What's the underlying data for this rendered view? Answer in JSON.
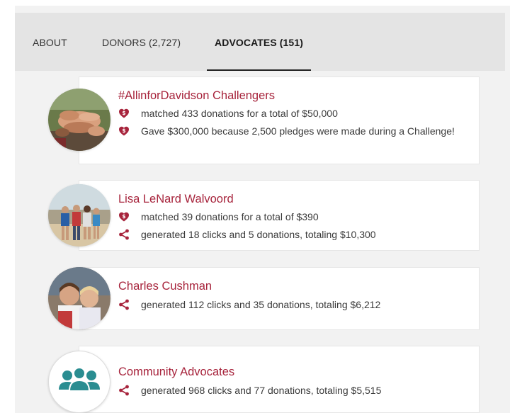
{
  "tabs": [
    {
      "label": "ABOUT",
      "active": false
    },
    {
      "label": "DONORS (2,727)",
      "active": false
    },
    {
      "label": "ADVOCATES (151)",
      "active": true
    }
  ],
  "colors": {
    "accent": "#a7243c",
    "share": "#a7243c",
    "community_icon": "#2a8d91"
  },
  "advocates": [
    {
      "name": "#AllinforDavidson Challengers",
      "avatar": "photo-hands-stacked",
      "lines": [
        {
          "icon": "heart-dollar-icon",
          "text": "matched 433 donations for a total of $50,000"
        },
        {
          "icon": "heart-dollar-icon",
          "text": "Gave $300,000 because 2,500 pledges were made during a Challenge!"
        }
      ]
    },
    {
      "name": "Lisa LeNard Walvoord",
      "avatar": "photo-family-beach",
      "lines": [
        {
          "icon": "heart-dollar-icon",
          "text": "matched 39 donations for a total of $390"
        },
        {
          "icon": "share-icon",
          "text": "generated 18 clicks and 5 donations, totaling $10,300"
        }
      ]
    },
    {
      "name": "Charles Cushman",
      "avatar": "photo-two-boys",
      "lines": [
        {
          "icon": "share-icon",
          "text": "generated 112 clicks and 35 donations, totaling $6,212"
        }
      ]
    },
    {
      "name": "Community Advocates",
      "avatar": "group-people-icon",
      "lines": [
        {
          "icon": "share-icon",
          "text": "generated 968 clicks and 77 donations, totaling $5,515"
        }
      ]
    }
  ]
}
